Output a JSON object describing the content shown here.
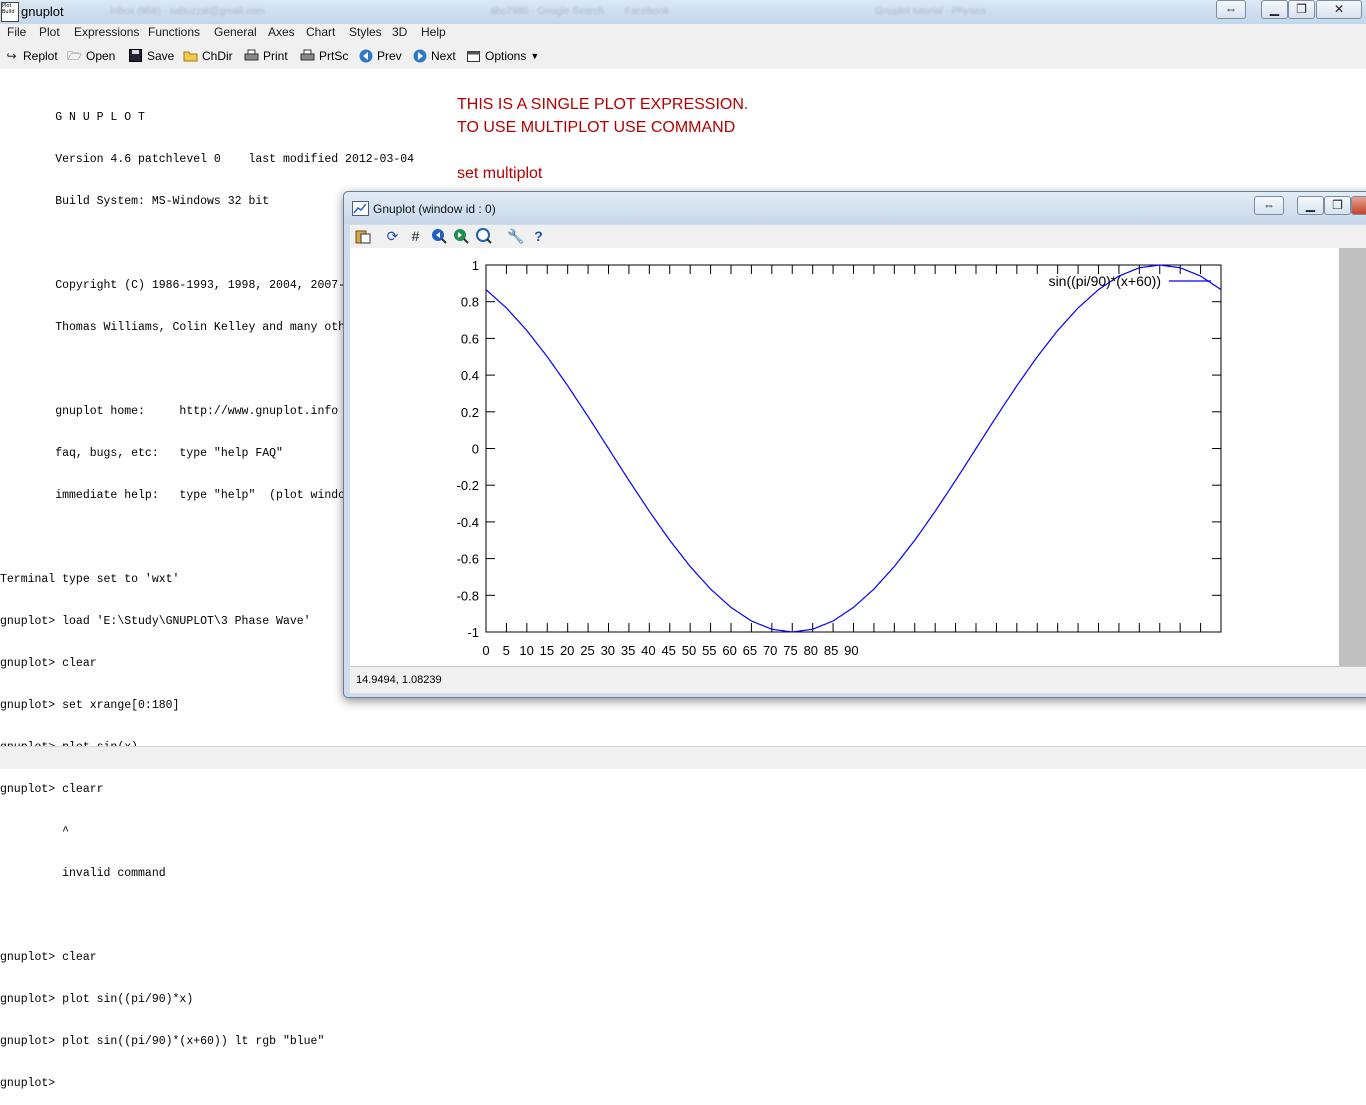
{
  "window": {
    "title": "gnuplot",
    "icon_text": "Plot Build",
    "blurred_tabs": [
      "Inbox (956) - sabuzzal@gmail.com",
      "abc7980 - Google Search",
      "Facebook",
      "Gnuplot tutorial - Physics"
    ]
  },
  "menu": [
    "File",
    "Plot",
    "Expressions",
    "Functions",
    "General",
    "Axes",
    "Chart",
    "Styles",
    "3D",
    "Help"
  ],
  "toolbar": {
    "replot": "Replot",
    "open": "Open",
    "save": "Save",
    "chdir": "ChDir",
    "print": "Print",
    "prtsc": "PrtSc",
    "prev": "Prev",
    "next": "Next",
    "options": "Options"
  },
  "console_lines": [
    "        G N U P L O T",
    "        Version 4.6 patchlevel 0    last modified 2012-03-04",
    "        Build System: MS-Windows 32 bit",
    "",
    "        Copyright (C) 1986-1993, 1998, 2004, 2007-2012",
    "        Thomas Williams, Colin Kelley and many others",
    "",
    "        gnuplot home:     http://www.gnuplot.info",
    "        faq, bugs, etc:   type \"help FAQ\"",
    "        immediate help:   type \"help\"  (plot window: hit 'h')",
    "",
    "Terminal type set to 'wxt'",
    "gnuplot> load 'E:\\Study\\GNUPLOT\\3 Phase Wave'",
    "gnuplot> clear",
    "gnuplot> set xrange[0:180]",
    "gnuplot> plot sin(x)",
    "gnuplot> clearr",
    "         ^",
    "         invalid command",
    "",
    "gnuplot> clear",
    "gnuplot> plot sin((pi/90)*x)",
    "gnuplot> plot sin((pi/90)*(x+60)) lt rgb \"blue\"",
    "gnuplot> "
  ],
  "notes": {
    "line1": "THIS IS A SINGLE PLOT EXPRESSION.",
    "line2": "TO USE MULTIPLOT USE COMMAND",
    "line3": "set multiplot"
  },
  "plot_window": {
    "title": "Gnuplot (window id : 0)",
    "status_coords": "14.9494,  1.08239"
  },
  "colors": {
    "note_red": "#b40000",
    "curve_blue": "#0000ff"
  },
  "chart_data": {
    "type": "line",
    "series": [
      {
        "name": "sin((pi/90)*(x+60))",
        "x": [
          0,
          5,
          10,
          15,
          20,
          25,
          30,
          35,
          40,
          45,
          50,
          55,
          60,
          65,
          70,
          75,
          80,
          85,
          90,
          95,
          100,
          105,
          110,
          115,
          120,
          125,
          130,
          135,
          140,
          145,
          150,
          155,
          160,
          165,
          170,
          175,
          180
        ],
        "y": [
          0.866,
          0.766,
          0.643,
          0.5,
          0.342,
          0.174,
          0.0,
          -0.174,
          -0.342,
          -0.5,
          -0.643,
          -0.766,
          -0.866,
          -0.94,
          -0.985,
          -1.0,
          -0.985,
          -0.94,
          -0.866,
          -0.766,
          -0.643,
          -0.5,
          -0.342,
          -0.174,
          0.0,
          0.174,
          0.342,
          0.5,
          0.643,
          0.766,
          0.866,
          0.94,
          0.985,
          1.0,
          0.985,
          0.94,
          0.866
        ]
      }
    ],
    "xlim": [
      0,
      180
    ],
    "ylim": [
      -1,
      1
    ],
    "x_tick_labels": [
      "0",
      "5",
      "10",
      "15",
      "20",
      "25",
      "30",
      "35",
      "40",
      "45",
      "50",
      "55",
      "60",
      "65",
      "70",
      "75",
      "80",
      "85",
      "90"
    ],
    "y_tick_labels": [
      "1",
      "0.8",
      "0.6",
      "0.4",
      "0.2",
      "0",
      "-0.2",
      "-0.4",
      "-0.6",
      "-0.8",
      "-1"
    ],
    "legend_position": "top-right",
    "grid": false
  }
}
